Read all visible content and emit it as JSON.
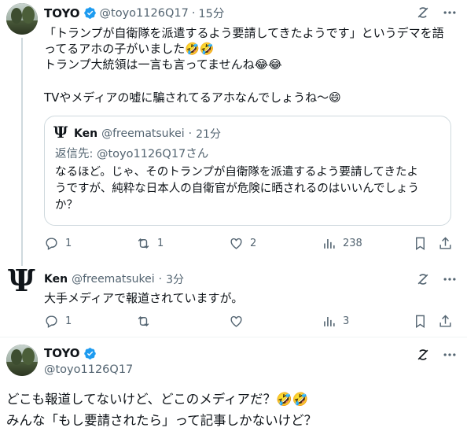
{
  "tweet1": {
    "name": "TOYO",
    "handle": "@toyo1126Q17",
    "time_sep": "·",
    "time": "15分",
    "lines": [
      "「トランプが自衛隊を派遣するよう要請してきたようです」というデマを語",
      "ってるアホの子がいました🤣🤣",
      "トランプ大統領は一言も言ってませんね😂😂",
      "",
      "TVやメディアの嘘に騙されてるアホなんでしょうね〜😄"
    ],
    "quote": {
      "name": "Ken",
      "handle": "@freematsukei",
      "time_sep": "·",
      "time": "21分",
      "reply_prefix": "返信先: ",
      "reply_to": "@toyo1126Q17さん",
      "lines": [
        "なるほど。じゃ、そのトランプが自衛隊を派遣するよう要請してきたよ",
        "うですが、純粋な日本人の自衛官が危険に晒されるのはいいんでしょう",
        "か？"
      ]
    },
    "actions": {
      "replies": "1",
      "retweets": "1",
      "likes": "2",
      "views": "238"
    }
  },
  "tweet2": {
    "name": "Ken",
    "handle": "@freematsukei",
    "time_sep": "·",
    "time": "3分",
    "text": "大手メディアで報道されていますが。",
    "actions": {
      "replies": "1",
      "retweets": "",
      "likes": "",
      "views": "3"
    }
  },
  "tweet3": {
    "name": "TOYO",
    "handle": "@toyo1126Q17",
    "lines": [
      "どこも報道してないけど、どこのメディアだ？🤣🤣",
      "みんな「もし要請されたら」って記事しかないけど？"
    ]
  },
  "colors": {
    "text": "#0f1419",
    "secondary": "#536471",
    "verified": "#1d9bf0",
    "border": "#cfd9de"
  },
  "icons": [
    "grok-icon",
    "more-icon",
    "reply-icon",
    "retweet-icon",
    "like-icon",
    "views-icon",
    "bookmark-icon",
    "share-icon",
    "verified-badge-icon",
    "psi-avatar-icon"
  ]
}
